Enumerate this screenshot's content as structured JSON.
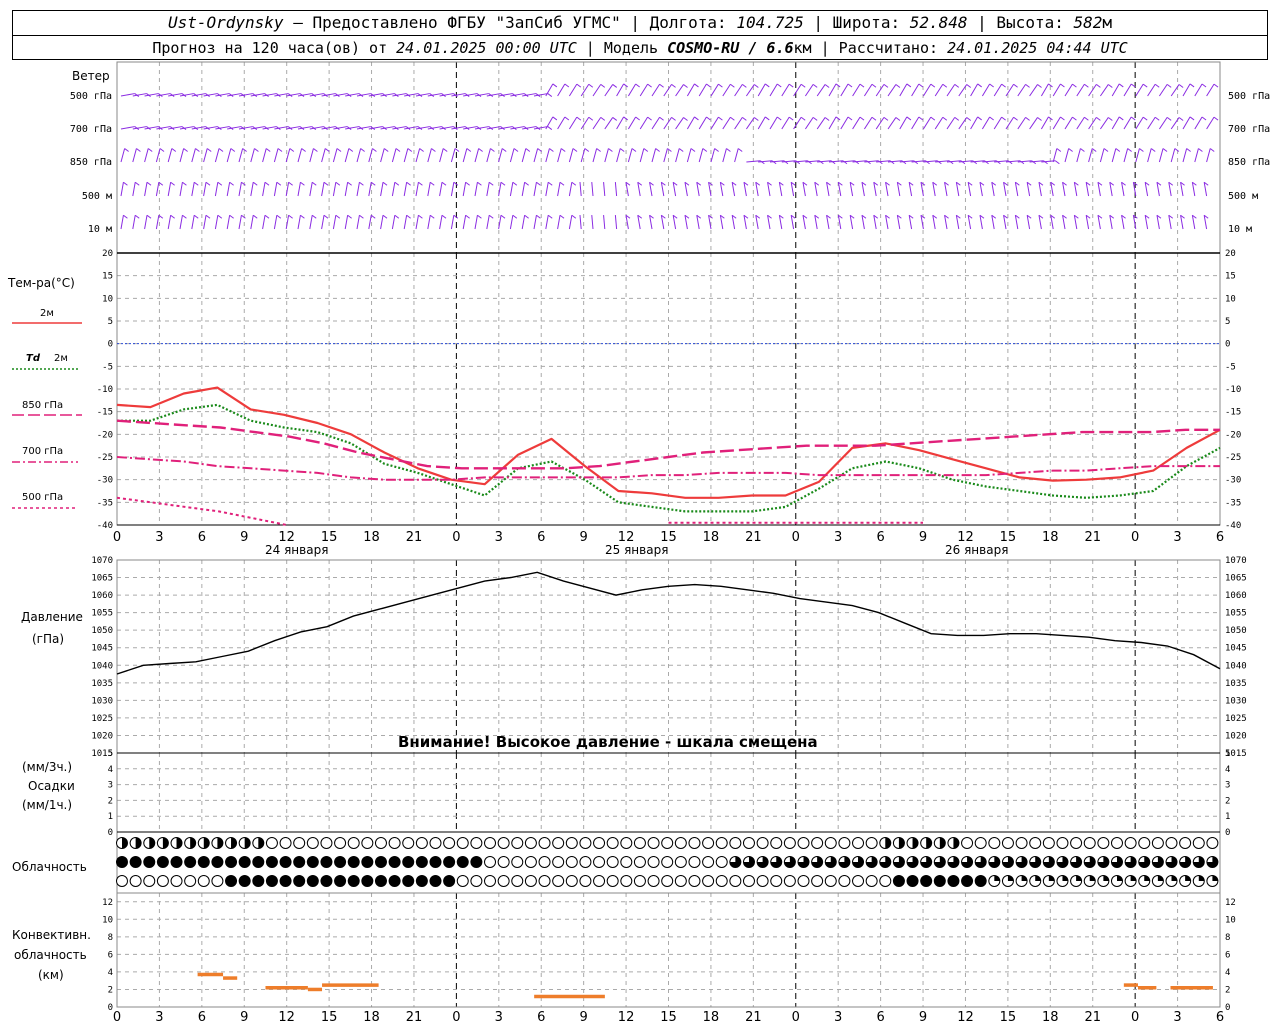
{
  "header": {
    "station": "Ust-Ordynsky",
    "provider": " — Предоставлено ФГБУ \"ЗапСиб УГМС\" | Долгота: ",
    "lon": "104.725",
    "lat_label": " | Широта: ",
    "lat": "52.848",
    "alt_label": " | Высота: ",
    "alt": "582",
    "alt_unit": "м",
    "forecast_label": "Прогноз на 120 часа(ов) от ",
    "forecast_time": "24.01.2025 00:00 UTC",
    "model_label": "  | Модель ",
    "model": "COSMO-RU / 6.6",
    "model_unit": "км",
    "calc_label": " | Рассчитано: ",
    "calc_time": "24.01.2025 04:44 UTC"
  },
  "labels": {
    "wind": "Ветер",
    "wind_levels": [
      "500 гПа",
      "700 гПа",
      "850 гПа",
      "500 м",
      "10  м"
    ],
    "temp_title": "Тем-ра(°C)",
    "t2m": "2м",
    "td_prefix": "Td",
    "td2m": "2м",
    "t850": "850 гПа",
    "t700": "700 гПа",
    "t500": "500 гПа",
    "pressure": "Давление",
    "pressure_unit": "(гПа)",
    "precip_unit3": "(мм/3ч.)",
    "precip": "Осадки",
    "precip_unit1": "(мм/1ч.)",
    "cloud": "Облачность",
    "conv1": "Конвективн.",
    "conv2": "облачность",
    "conv3": "(км)",
    "warning": "Внимание! Высокое давление - шкала смещена",
    "days": [
      "24 января",
      "25 января",
      "26 января"
    ]
  },
  "chart_data": [
    {
      "type": "line",
      "title": "Тем-ра(°C)",
      "x_hours": [
        0,
        3,
        6,
        9,
        12,
        15,
        18,
        21,
        24,
        27,
        30,
        33,
        36,
        39,
        42,
        45,
        48,
        51,
        54,
        57,
        60,
        63,
        66,
        69,
        72,
        75,
        78
      ],
      "x_tick_labels": [
        "0",
        "3",
        "6",
        "9",
        "12",
        "15",
        "18",
        "21",
        "0",
        "3",
        "6",
        "9",
        "12",
        "15",
        "18",
        "21",
        "0",
        "3",
        "6",
        "9",
        "12",
        "15",
        "18",
        "21",
        "0",
        "3",
        "6"
      ],
      "ylim": [
        -40,
        20
      ],
      "y_ticks": [
        20,
        15,
        10,
        5,
        0,
        -5,
        -10,
        -15,
        -20,
        -25,
        -30,
        -35,
        -40
      ],
      "series": [
        {
          "name": "2м",
          "color": "#ee3b3b",
          "style": "solid",
          "values": [
            -13.5,
            -14,
            -11,
            -9.7,
            -14.5,
            -15.7,
            -17.5,
            -20,
            -24,
            -27.5,
            -30,
            -31,
            -24.5,
            -21,
            -27,
            -32.5,
            -33,
            -34,
            -34,
            -33.5,
            -33.5,
            -30.5,
            -23,
            -22,
            -23.5,
            -25.5,
            -27.5,
            -29.5,
            -30.2,
            -30,
            -29.5,
            -28,
            -23,
            -19
          ]
        },
        {
          "name": "Td 2м",
          "color": "#1a8a1a",
          "style": "dotted",
          "values": [
            -17,
            -17,
            -14.5,
            -13.5,
            -17,
            -18.5,
            -19.5,
            -22,
            -26.5,
            -28.5,
            -31,
            -33.5,
            -27.5,
            -26,
            -30,
            -35,
            -36,
            -37,
            -37,
            -37,
            -36,
            -32,
            -27.5,
            -26,
            -27.5,
            -30,
            -31.5,
            -32.5,
            -33.5,
            -34,
            -33.5,
            -32.5,
            -27,
            -23
          ]
        },
        {
          "name": "850 гПа",
          "color": "#e0207a",
          "style": "longdash",
          "values": [
            -17,
            -17.5,
            -18,
            -18.5,
            -19.5,
            -20.5,
            -22,
            -24,
            -25.5,
            -27,
            -27.5,
            -27.5,
            -27.5,
            -27.5,
            -27,
            -26,
            -25,
            -24,
            -23.5,
            -23,
            -22.5,
            -22.5,
            -22.5,
            -22,
            -21.5,
            -21,
            -20.5,
            -20,
            -19.5,
            -19.5,
            -19.5,
            -19,
            -19
          ]
        },
        {
          "name": "700 гПа",
          "color": "#e0207a",
          "style": "dashdot",
          "values": [
            -25,
            -25.5,
            -26,
            -27,
            -27.5,
            -28,
            -28.5,
            -29.5,
            -30,
            -30,
            -30,
            -29.5,
            -29.5,
            -29.5,
            -29.5,
            -29.5,
            -29,
            -29,
            -28.5,
            -28.5,
            -28.5,
            -29,
            -29,
            -29,
            -29,
            -29,
            -29,
            -28.5,
            -28,
            -28,
            -27.5,
            -27,
            -27,
            -27
          ]
        },
        {
          "name": "500 гПа",
          "color": "#e0207a",
          "style": "shortdash",
          "values": [
            -34,
            -35,
            -36,
            -37,
            -38.5,
            -40
          ]
        },
        {
          "name": "500 гПа (scale bottom)",
          "color": "#e0207a",
          "style": "shortdash",
          "x_from": 39,
          "x_to": 57,
          "values": [
            -39.5,
            -39.5
          ]
        }
      ]
    },
    {
      "type": "line",
      "title": "Давление",
      "ylabel": "(гПа)",
      "ylim": [
        1015,
        1070
      ],
      "y_ticks": [
        1070,
        1065,
        1060,
        1055,
        1050,
        1045,
        1040,
        1035,
        1030,
        1025,
        1020,
        1015
      ],
      "series": [
        {
          "name": "Давление",
          "color": "#000000",
          "values": [
            1037.5,
            1040,
            1040.5,
            1041,
            1042.5,
            1044,
            1047,
            1049.5,
            1051,
            1054,
            1056,
            1058,
            1060,
            1062,
            1064,
            1065,
            1066.5,
            1064,
            1062,
            1060,
            1061.5,
            1062.5,
            1063,
            1062.5,
            1061.5,
            1060.5,
            1059,
            1058,
            1057,
            1055,
            1052,
            1049,
            1048.5,
            1048.5,
            1049,
            1049,
            1048.5,
            1048,
            1047,
            1046.5,
            1045.5,
            1043,
            1039
          ]
        }
      ]
    },
    {
      "type": "line",
      "title": "Осадки",
      "ylim": [
        0,
        5
      ],
      "y_ticks": [
        5,
        4,
        3,
        2,
        1,
        0
      ],
      "series": []
    },
    {
      "type": "bar",
      "title": "Конвективн. облачность (км)",
      "ylim": [
        0,
        13
      ],
      "y_ticks": [
        12,
        10,
        8,
        6,
        4,
        2,
        0
      ],
      "segments": [
        {
          "x_from": 5.7,
          "x_to": 7.5,
          "y": 3.7
        },
        {
          "x_from": 7.5,
          "x_to": 8.5,
          "y": 3.3
        },
        {
          "x_from": 10.5,
          "x_to": 13.5,
          "y": 2.2
        },
        {
          "x_from": 13.5,
          "x_to": 14.5,
          "y": 2.0
        },
        {
          "x_from": 14.5,
          "x_to": 18.5,
          "y": 2.5
        },
        {
          "x_from": 29.5,
          "x_to": 34.5,
          "y": 1.2
        },
        {
          "x_from": 71.2,
          "x_to": 72.2,
          "y": 2.5
        },
        {
          "x_from": 72.2,
          "x_to": 73.5,
          "y": 2.2
        },
        {
          "x_from": 74.5,
          "x_to": 77.5,
          "y": 2.2
        }
      ],
      "color": "#ee7d2a"
    }
  ]
}
